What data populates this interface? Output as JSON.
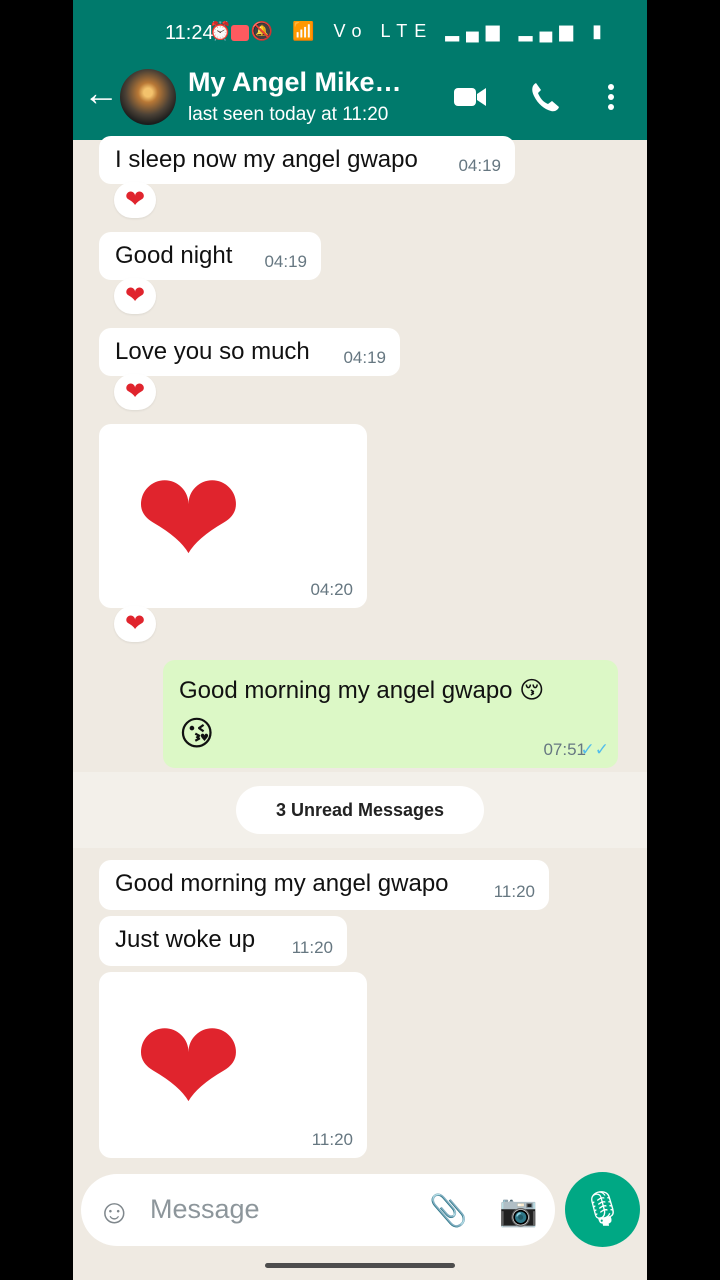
{
  "status": {
    "time": "11:24",
    "icons": "⏰ 🔕 📶 Vo LTE ▂▄▆ ▂▄▆ ▮"
  },
  "header": {
    "back": "←",
    "title": "My Angel Mike…",
    "subtitle": "last seen today at 11:20",
    "video": "video-call",
    "call": "voice-call",
    "menu": "more-options"
  },
  "messages": [
    {
      "text": "I sleep now my angel gwapo",
      "time": "04:19",
      "reaction": "❤"
    },
    {
      "text": "Good night",
      "time": "04:19",
      "reaction": "❤"
    },
    {
      "text": "Love you so much",
      "time": "04:19",
      "reaction": "❤"
    },
    {
      "sticker": "❤",
      "time": "04:20",
      "reaction": "❤"
    },
    {
      "text": "Good morning my angel gwapo 😚",
      "text2": "😘",
      "time": "07:51",
      "ticks": "✓✓"
    },
    {
      "text": "Good morning my angel gwapo",
      "time": "11:20"
    },
    {
      "text": "Just woke up",
      "time": "11:20"
    },
    {
      "sticker": "❤",
      "time": "11:20"
    }
  ],
  "unread": "3 Unread Messages",
  "composer": {
    "emoji": "☺",
    "placeholder": "Message",
    "attach": "📎",
    "camera": "📷",
    "mic": "🎙"
  },
  "colors": {
    "accent": "#007a6c",
    "chat_bg": "#efeae2",
    "incoming": "#ffffff",
    "outgoing": "#dcf8c6",
    "heart": "#e0242d"
  }
}
